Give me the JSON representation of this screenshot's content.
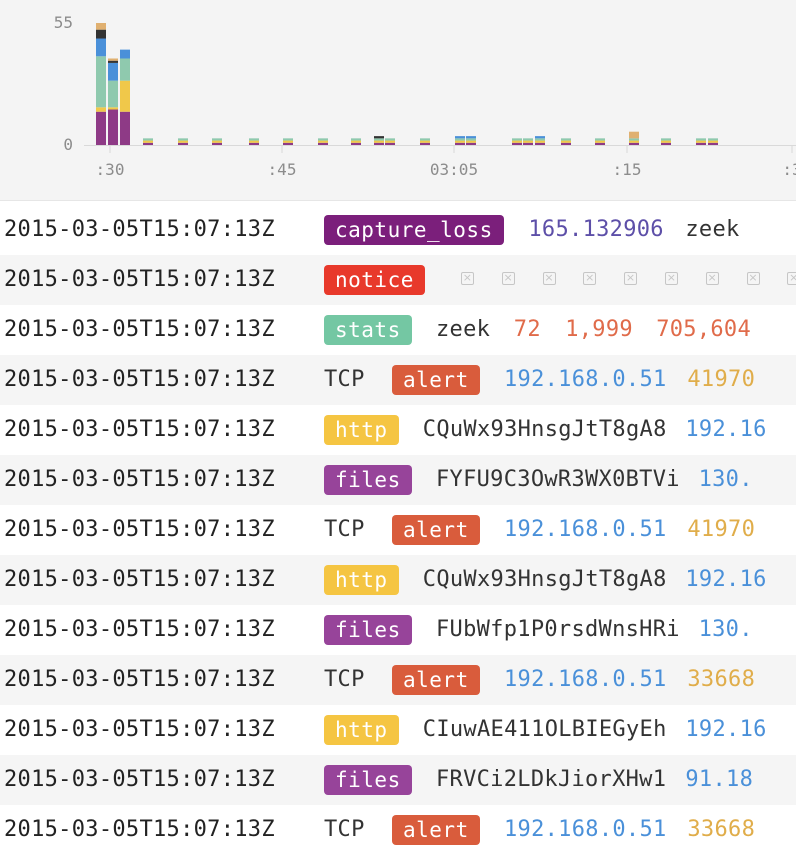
{
  "chart_data": {
    "type": "bar",
    "stacked": true,
    "y_ticks": [
      "55",
      "0"
    ],
    "ylim": [
      0,
      55
    ],
    "x_tick_labels": [
      ":30",
      ":45",
      "03:05",
      ":15",
      ":3"
    ],
    "colors": {
      "purple": "#8e3a86",
      "yellow": "#f0c84a",
      "teal": "#8fc9ae",
      "blue": "#4a90d9",
      "dark": "#333333",
      "orange": "#e07a3c",
      "tan": "#e0b070"
    },
    "series": [
      {
        "color": "purple",
        "values": [
          15,
          16,
          15,
          1,
          1,
          1,
          1,
          1,
          1,
          1,
          1,
          1,
          1,
          1,
          1,
          1,
          1,
          1,
          1,
          1,
          1,
          1,
          1,
          1
        ]
      },
      {
        "color": "yellow",
        "values": [
          2,
          1,
          14,
          1,
          1,
          1,
          1,
          1,
          1,
          1,
          1,
          1,
          1,
          1,
          1,
          1,
          1,
          1,
          1,
          1,
          1,
          1,
          1,
          1
        ]
      },
      {
        "color": "teal",
        "values": [
          23,
          12,
          10,
          1,
          1,
          1,
          1,
          1,
          1,
          1,
          1,
          1,
          1,
          1,
          1,
          1,
          1,
          1,
          1,
          1,
          1,
          1,
          1,
          1
        ]
      },
      {
        "color": "blue",
        "values": [
          8,
          8,
          4,
          0,
          0,
          0,
          0,
          0,
          0,
          0,
          0,
          0,
          0,
          1,
          1,
          0,
          0,
          1,
          0,
          0,
          0,
          0,
          0,
          0
        ]
      },
      {
        "color": "dark",
        "values": [
          4,
          1,
          0,
          0,
          0,
          0,
          0,
          0,
          0,
          0,
          1,
          0,
          0,
          0,
          0,
          0,
          0,
          0,
          0,
          0,
          0,
          0,
          0,
          0
        ]
      },
      {
        "color": "tan",
        "values": [
          3,
          1,
          0,
          0,
          0,
          0,
          0,
          0,
          0,
          0,
          0,
          0,
          0,
          0,
          0,
          0,
          0,
          0,
          0,
          0,
          3,
          0,
          0,
          0
        ]
      }
    ]
  },
  "events": [
    {
      "timestamp": "2015-03-05T15:07:13Z",
      "proto": "",
      "tag": "capture_loss",
      "tag_color": "#7b1f7b",
      "fields": [
        {
          "text": "165.132906",
          "kind": "float"
        },
        {
          "text": "zeek",
          "kind": "plain"
        }
      ]
    },
    {
      "timestamp": "2015-03-05T15:07:13Z",
      "proto": "",
      "tag": "notice",
      "tag_color": "#e8392b",
      "nulls": 9,
      "fields": []
    },
    {
      "timestamp": "2015-03-05T15:07:13Z",
      "proto": "",
      "tag": "stats",
      "tag_color": "#74c7a3",
      "fields": [
        {
          "text": "zeek",
          "kind": "plain"
        },
        {
          "text": "72",
          "kind": "num"
        },
        {
          "text": "1,999",
          "kind": "num"
        },
        {
          "text": "705,604",
          "kind": "num"
        }
      ]
    },
    {
      "timestamp": "2015-03-05T15:07:13Z",
      "proto": "TCP",
      "tag": "alert",
      "tag_color": "#d95c3c",
      "fields": [
        {
          "text": "192.168.0.51",
          "kind": "ip"
        },
        {
          "text": "41970",
          "kind": "port"
        }
      ]
    },
    {
      "timestamp": "2015-03-05T15:07:13Z",
      "proto": "",
      "tag": "http",
      "tag_color": "#f5c542",
      "fields": [
        {
          "text": "CQuWx93HnsgJtT8gA8",
          "kind": "plain"
        },
        {
          "text": "192.16",
          "kind": "ip"
        }
      ]
    },
    {
      "timestamp": "2015-03-05T15:07:13Z",
      "proto": "",
      "tag": "files",
      "tag_color": "#97449a",
      "fields": [
        {
          "text": "FYFU9C3OwR3WX0BTVi",
          "kind": "plain"
        },
        {
          "text": "130.",
          "kind": "ip"
        }
      ]
    },
    {
      "timestamp": "2015-03-05T15:07:13Z",
      "proto": "TCP",
      "tag": "alert",
      "tag_color": "#d95c3c",
      "fields": [
        {
          "text": "192.168.0.51",
          "kind": "ip"
        },
        {
          "text": "41970",
          "kind": "port"
        }
      ]
    },
    {
      "timestamp": "2015-03-05T15:07:13Z",
      "proto": "",
      "tag": "http",
      "tag_color": "#f5c542",
      "fields": [
        {
          "text": "CQuWx93HnsgJtT8gA8",
          "kind": "plain"
        },
        {
          "text": "192.16",
          "kind": "ip"
        }
      ]
    },
    {
      "timestamp": "2015-03-05T15:07:13Z",
      "proto": "",
      "tag": "files",
      "tag_color": "#97449a",
      "fields": [
        {
          "text": "FUbWfp1P0rsdWnsHRi",
          "kind": "plain"
        },
        {
          "text": "130.",
          "kind": "ip"
        }
      ]
    },
    {
      "timestamp": "2015-03-05T15:07:13Z",
      "proto": "TCP",
      "tag": "alert",
      "tag_color": "#d95c3c",
      "fields": [
        {
          "text": "192.168.0.51",
          "kind": "ip"
        },
        {
          "text": "33668",
          "kind": "port"
        }
      ]
    },
    {
      "timestamp": "2015-03-05T15:07:13Z",
      "proto": "",
      "tag": "http",
      "tag_color": "#f5c542",
      "fields": [
        {
          "text": "CIuwAE411OLBIEGyEh",
          "kind": "plain"
        },
        {
          "text": "192.16",
          "kind": "ip"
        }
      ]
    },
    {
      "timestamp": "2015-03-05T15:07:13Z",
      "proto": "",
      "tag": "files",
      "tag_color": "#97449a",
      "fields": [
        {
          "text": "FRVCi2LDkJiorXHw1",
          "kind": "plain"
        },
        {
          "text": "91.18",
          "kind": "ip"
        }
      ]
    },
    {
      "timestamp": "2015-03-05T15:07:13Z",
      "proto": "TCP",
      "tag": "alert",
      "tag_color": "#d95c3c",
      "fields": [
        {
          "text": "192.168.0.51",
          "kind": "ip"
        },
        {
          "text": "33668",
          "kind": "port"
        }
      ]
    }
  ]
}
